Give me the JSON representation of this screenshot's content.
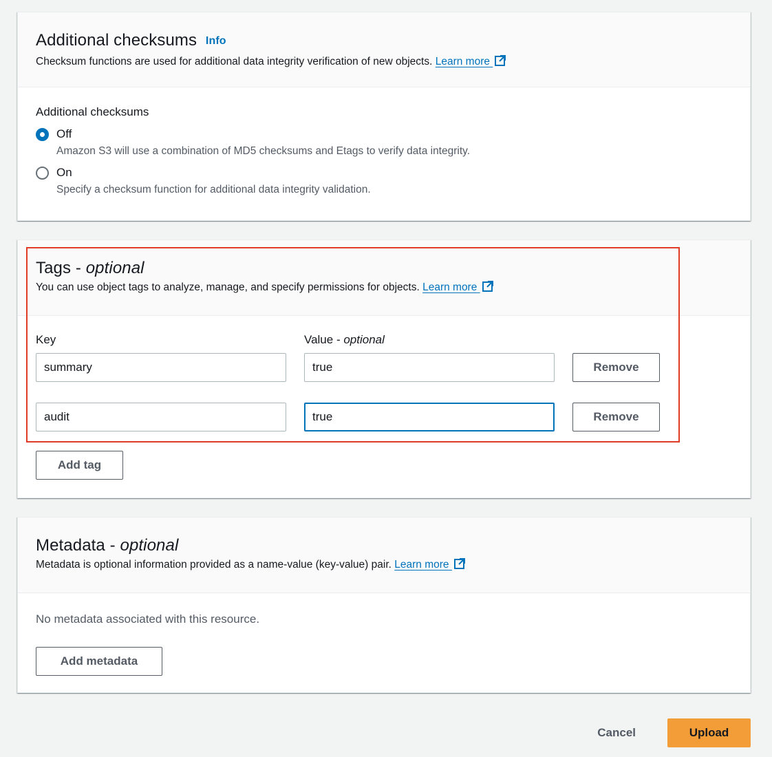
{
  "checksums": {
    "title": "Additional checksums",
    "info_label": "Info",
    "description": "Checksum functions are used for additional data integrity verification of new objects.",
    "learn_more": "Learn more",
    "field_label": "Additional checksums",
    "options": [
      {
        "label": "Off",
        "description": "Amazon S3 will use a combination of MD5 checksums and Etags to verify data integrity.",
        "selected": true
      },
      {
        "label": "On",
        "description": "Specify a checksum function for additional data integrity validation.",
        "selected": false
      }
    ]
  },
  "tags": {
    "title": "Tags - ",
    "title_optional": "optional",
    "description": "You can use object tags to analyze, manage, and specify permissions for objects.",
    "learn_more": "Learn more",
    "key_label": "Key",
    "value_label": "Value - ",
    "value_optional": "optional",
    "rows": [
      {
        "key": "summary",
        "value": "true",
        "remove_label": "Remove"
      },
      {
        "key": "audit",
        "value": "true",
        "remove_label": "Remove"
      }
    ],
    "add_label": "Add tag"
  },
  "metadata": {
    "title": "Metadata - ",
    "title_optional": "optional",
    "description": "Metadata is optional information provided as a name-value (key-value) pair.",
    "learn_more": "Learn more",
    "empty_message": "No metadata associated with this resource.",
    "add_label": "Add metadata"
  },
  "footer": {
    "cancel_label": "Cancel",
    "upload_label": "Upload"
  },
  "colors": {
    "link": "#0073bb",
    "primary": "#f29d38",
    "highlight": "#e03b24"
  },
  "icons": {
    "external": "external-link-icon"
  }
}
